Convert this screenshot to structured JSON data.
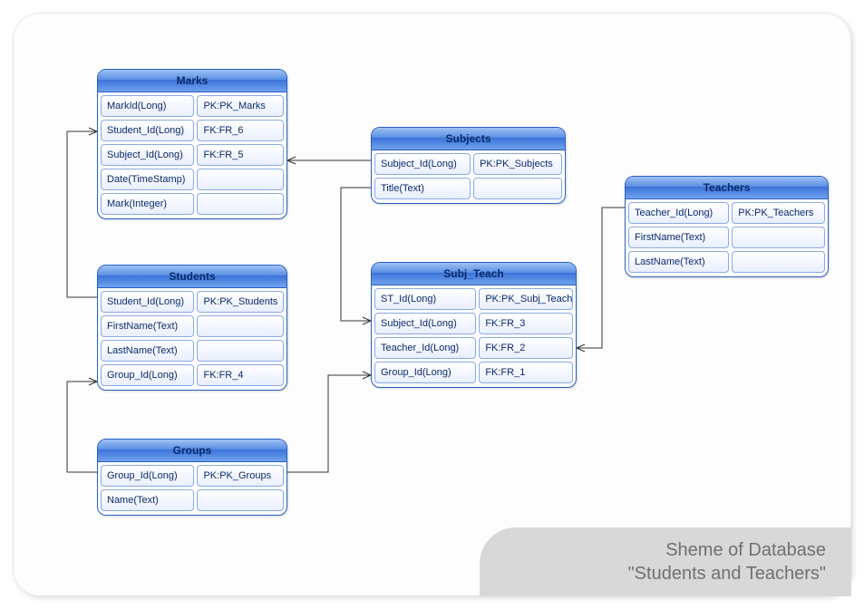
{
  "title_line1": "Sheme of Database",
  "title_line2": "\"Students and Teachers\"",
  "entities": {
    "marks": {
      "title": "Marks",
      "fields": [
        {
          "name": "MarkId(Long)",
          "key": "PK:PK_Marks"
        },
        {
          "name": "Student_Id(Long)",
          "key": "FK:FR_6"
        },
        {
          "name": "Subject_Id(Long)",
          "key": "FK:FR_5"
        },
        {
          "name": "Date(TimeStamp)",
          "key": ""
        },
        {
          "name": "Mark(Integer)",
          "key": ""
        }
      ]
    },
    "subjects": {
      "title": "Subjects",
      "fields": [
        {
          "name": "Subject_Id(Long)",
          "key": "PK:PK_Subjects"
        },
        {
          "name": "Title(Text)",
          "key": ""
        }
      ]
    },
    "teachers": {
      "title": "Teachers",
      "fields": [
        {
          "name": "Teacher_Id(Long)",
          "key": "PK:PK_Teachers"
        },
        {
          "name": "FirstName(Text)",
          "key": ""
        },
        {
          "name": "LastName(Text)",
          "key": ""
        }
      ]
    },
    "students": {
      "title": "Students",
      "fields": [
        {
          "name": "Student_Id(Long)",
          "key": "PK:PK_Students"
        },
        {
          "name": "FirstName(Text)",
          "key": ""
        },
        {
          "name": "LastName(Text)",
          "key": ""
        },
        {
          "name": "Group_Id(Long)",
          "key": "FK:FR_4"
        }
      ]
    },
    "subj_teach": {
      "title": "Subj_Teach",
      "fields": [
        {
          "name": "ST_Id(Long)",
          "key": "PK:PK_Subj_Teach"
        },
        {
          "name": "Subject_Id(Long)",
          "key": "FK:FR_3"
        },
        {
          "name": "Teacher_Id(Long)",
          "key": "FK:FR_2"
        },
        {
          "name": "Group_Id(Long)",
          "key": "FK:FR_1"
        }
      ]
    },
    "groups": {
      "title": "Groups",
      "fields": [
        {
          "name": "Group_Id(Long)",
          "key": "PK:PK_Groups"
        },
        {
          "name": "Name(Text)",
          "key": ""
        }
      ]
    }
  }
}
